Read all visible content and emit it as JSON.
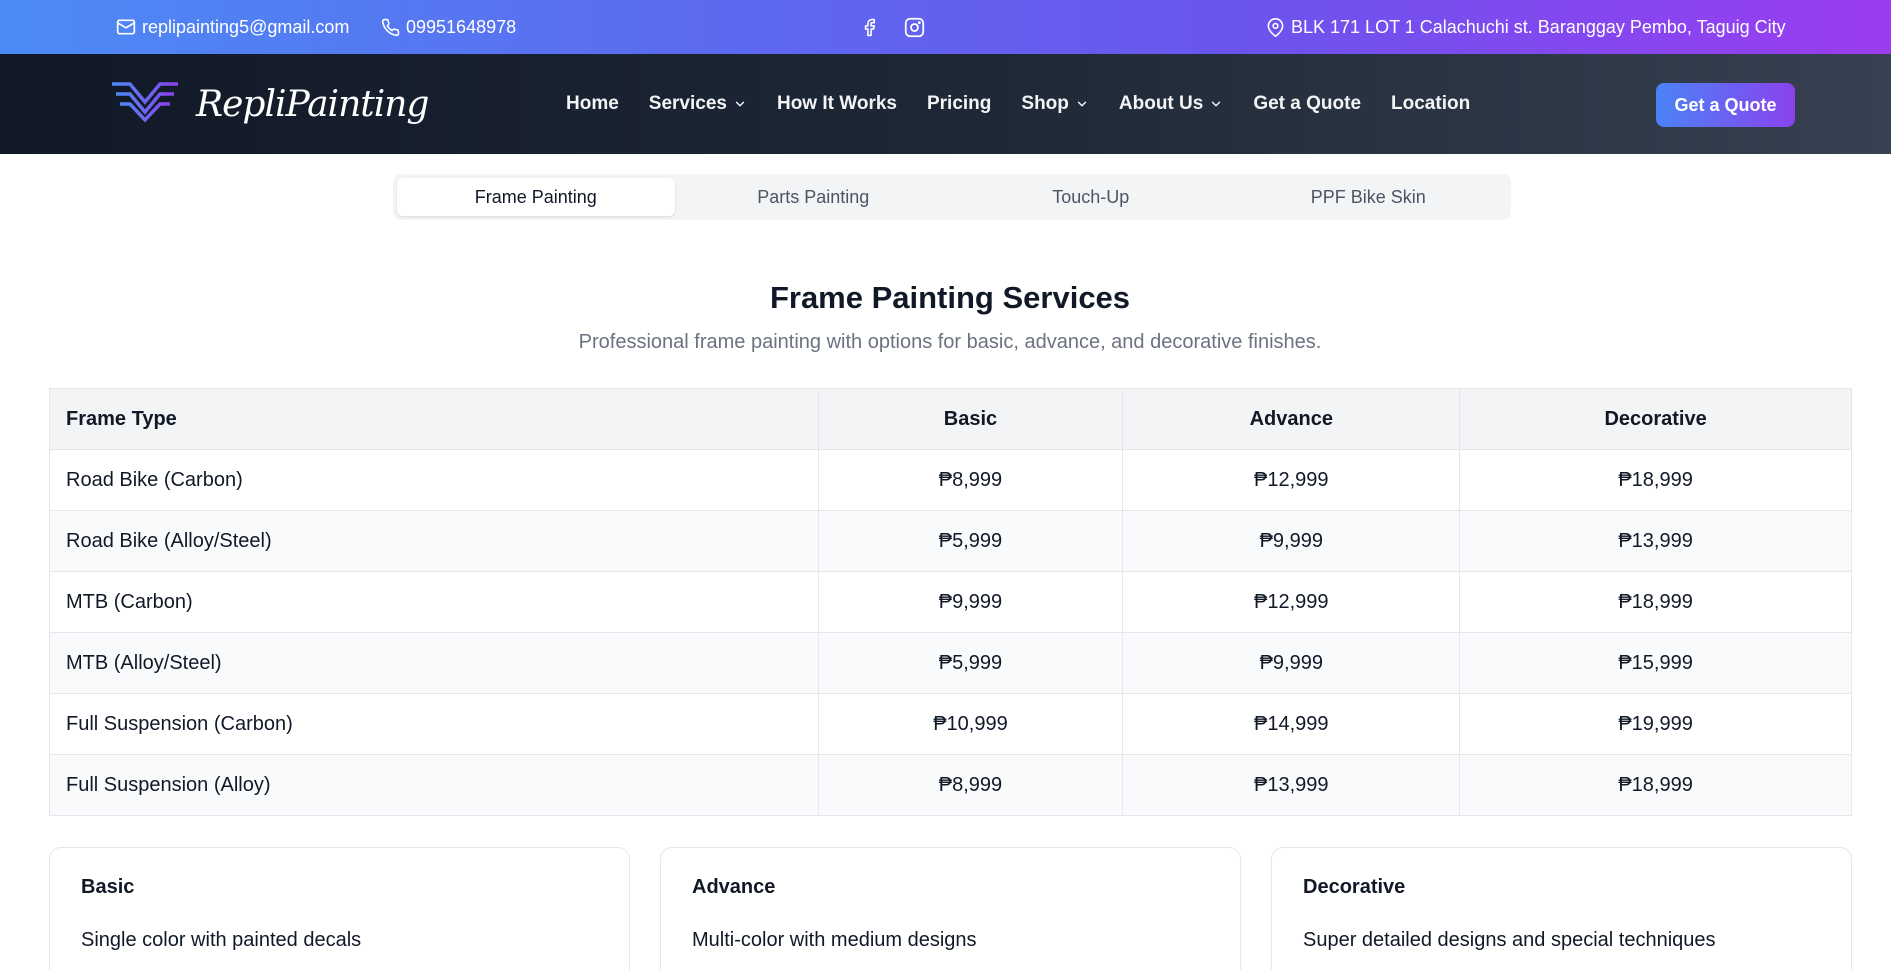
{
  "topbar": {
    "email": "replipainting5@gmail.com",
    "phone": "09951648978",
    "address": "BLK 171 LOT 1 Calachuchi st. Baranggay Pembo, Taguig City"
  },
  "brand": {
    "logo_text": "RepliPainting"
  },
  "nav": {
    "items": [
      {
        "label": "Home",
        "dropdown": false
      },
      {
        "label": "Services",
        "dropdown": true
      },
      {
        "label": "How It Works",
        "dropdown": false
      },
      {
        "label": "Pricing",
        "dropdown": false
      },
      {
        "label": "Shop",
        "dropdown": true
      },
      {
        "label": "About Us",
        "dropdown": true
      },
      {
        "label": "Get a Quote",
        "dropdown": false
      },
      {
        "label": "Location",
        "dropdown": false
      }
    ],
    "cta_label": "Get a Quote"
  },
  "tabs": [
    {
      "label": "Frame Painting",
      "active": true
    },
    {
      "label": "Parts Painting",
      "active": false
    },
    {
      "label": "Touch-Up",
      "active": false
    },
    {
      "label": "PPF Bike Skin",
      "active": false
    }
  ],
  "section": {
    "title": "Frame Painting Services",
    "subtitle": "Professional frame painting with options for basic, advance, and decorative finishes."
  },
  "table": {
    "headers": [
      "Frame Type",
      "Basic",
      "Advance",
      "Decorative"
    ],
    "rows": [
      [
        "Road Bike (Carbon)",
        "₱8,999",
        "₱12,999",
        "₱18,999"
      ],
      [
        "Road Bike (Alloy/Steel)",
        "₱5,999",
        "₱9,999",
        "₱13,999"
      ],
      [
        "MTB (Carbon)",
        "₱9,999",
        "₱12,999",
        "₱18,999"
      ],
      [
        "MTB (Alloy/Steel)",
        "₱5,999",
        "₱9,999",
        "₱15,999"
      ],
      [
        "Full Suspension (Carbon)",
        "₱10,999",
        "₱14,999",
        "₱19,999"
      ],
      [
        "Full Suspension (Alloy)",
        "₱8,999",
        "₱13,999",
        "₱18,999"
      ]
    ]
  },
  "cards": [
    {
      "title": "Basic",
      "description": "Single color with painted decals"
    },
    {
      "title": "Advance",
      "description": "Multi-color with medium designs"
    },
    {
      "title": "Decorative",
      "description": "Super detailed designs and special techniques"
    }
  ],
  "colors": {
    "topbar_gradient_start": "#4c8bf5",
    "topbar_gradient_end": "#9a3cf0",
    "navbar_bg": "#111827",
    "cta_gradient_start": "#4b83f7",
    "cta_gradient_end": "#8a42ee"
  }
}
